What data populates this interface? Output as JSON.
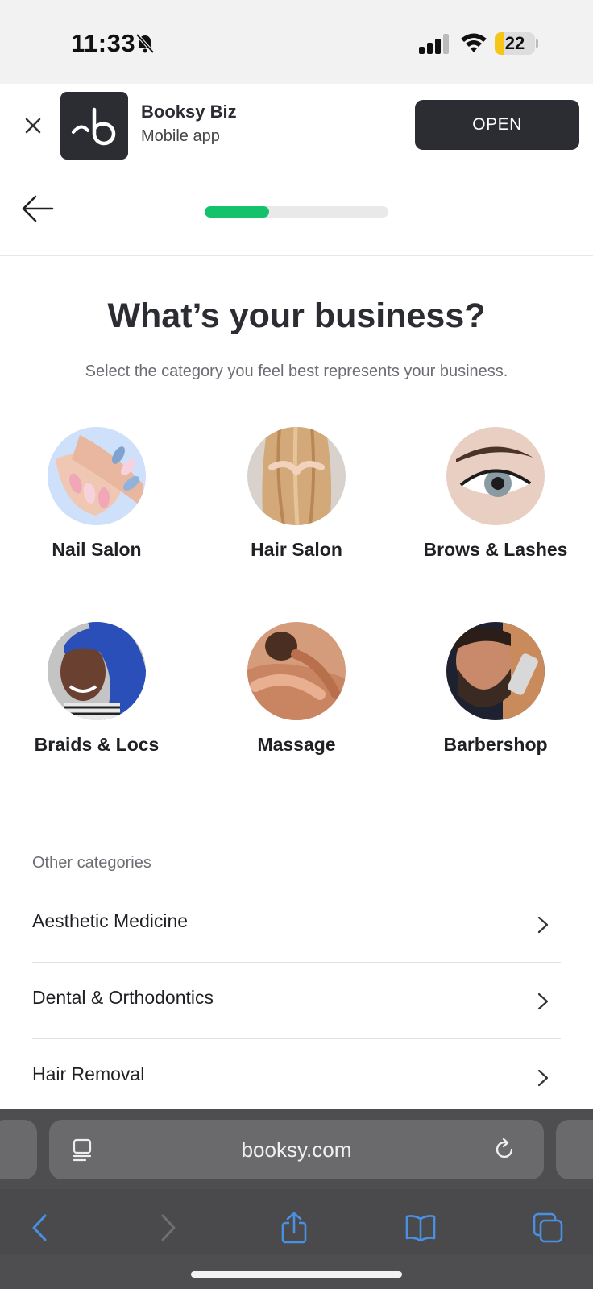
{
  "status_bar": {
    "time": "11:33",
    "battery_level": "22",
    "battery_fraction": 0.22,
    "icons": [
      "bell-slash-icon",
      "signal-icon",
      "wifi-icon",
      "battery-icon"
    ]
  },
  "app_banner": {
    "app_name": "Booksy Biz",
    "app_subtitle": "Mobile app",
    "open_label": "OPEN",
    "icons": [
      "close-icon",
      "booksy-logo-icon"
    ]
  },
  "progress": {
    "fraction": 0.35,
    "color": "#14c26b"
  },
  "page": {
    "title": "What’s your business?",
    "subtitle": "Select the category you feel best represents your business."
  },
  "categories": [
    {
      "label": "Nail Salon",
      "image": "nail-salon-photo"
    },
    {
      "label": "Hair Salon",
      "image": "hair-salon-photo"
    },
    {
      "label": "Brows & Lashes",
      "image": "brows-lashes-photo"
    },
    {
      "label": "Braids & Locs",
      "image": "braids-locs-photo"
    },
    {
      "label": "Massage",
      "image": "massage-photo"
    },
    {
      "label": "Barbershop",
      "image": "barbershop-photo"
    }
  ],
  "other": {
    "heading": "Other categories",
    "items": [
      {
        "label": "Aesthetic Medicine"
      },
      {
        "label": "Dental & Orthodontics"
      },
      {
        "label": "Hair Removal"
      }
    ]
  },
  "browser": {
    "url": "booksy.com",
    "icons": [
      "reader-icon",
      "reload-icon",
      "back-icon",
      "forward-icon",
      "share-icon",
      "bookmarks-icon",
      "tabs-icon"
    ],
    "accent": "#4a90e2"
  }
}
